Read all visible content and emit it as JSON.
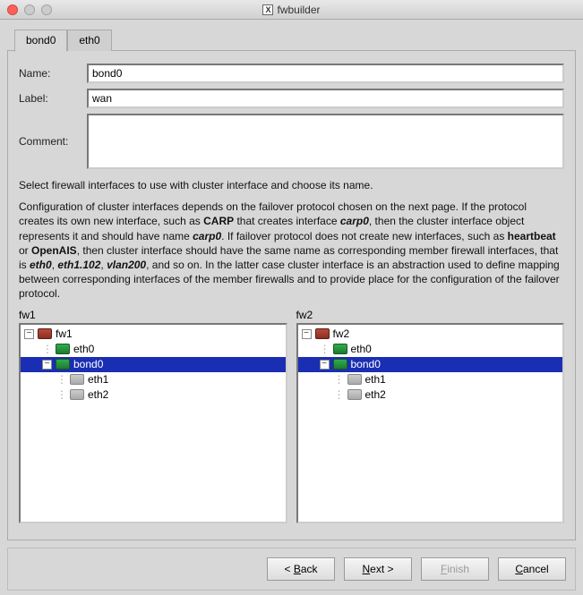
{
  "window": {
    "title": "fwbuilder"
  },
  "tabs": {
    "active": "bond0",
    "items": [
      "bond0",
      "eth0"
    ]
  },
  "form": {
    "name_label": "Name:",
    "name_value": "bond0",
    "label_label": "Label:",
    "label_value": "wan",
    "comment_label": "Comment:",
    "comment_value": ""
  },
  "description": {
    "line1": "Select firewall interfaces to use with cluster interface and choose its name.",
    "para_parts": {
      "p1": "Configuration of cluster interfaces depends on the failover protocol chosen on the next page. If the protocol creates its own new interface, such as ",
      "b1": "CARP",
      "p2": " that creates interface ",
      "bi1": "carp0",
      "p3": ", then the cluster interface object represents it and should have name ",
      "bi2": "carp0",
      "p4": ". If failover protocol does not create new interfaces, such as ",
      "b2": "heartbeat",
      "p5": " or ",
      "b3": "OpenAIS",
      "p6": ", then cluster interface should have the same name as corresponding member firewall interfaces, that is ",
      "bi3": "eth0",
      "p7": ", ",
      "bi4": "eth1.102",
      "p8": ", ",
      "bi5": "vlan200",
      "p9": ", and so on. In the latter case cluster interface is an abstraction used to define mapping between corresponding interfaces of the member firewalls and to provide place for the configuration of the failover protocol."
    }
  },
  "trees": {
    "left": {
      "label": "fw1",
      "root": "fw1",
      "rows": [
        {
          "name": "eth0",
          "icon": "if"
        },
        {
          "name": "bond0",
          "icon": "if",
          "selected": true,
          "children": [
            "eth1",
            "eth2"
          ]
        }
      ]
    },
    "right": {
      "label": "fw2",
      "root": "fw2",
      "rows": [
        {
          "name": "eth0",
          "icon": "if"
        },
        {
          "name": "bond0",
          "icon": "if",
          "selected": true,
          "children": [
            "eth1",
            "eth2"
          ]
        }
      ]
    }
  },
  "buttons": {
    "back": "< Back",
    "next": "Next >",
    "finish": "Finish",
    "cancel": "Cancel"
  }
}
